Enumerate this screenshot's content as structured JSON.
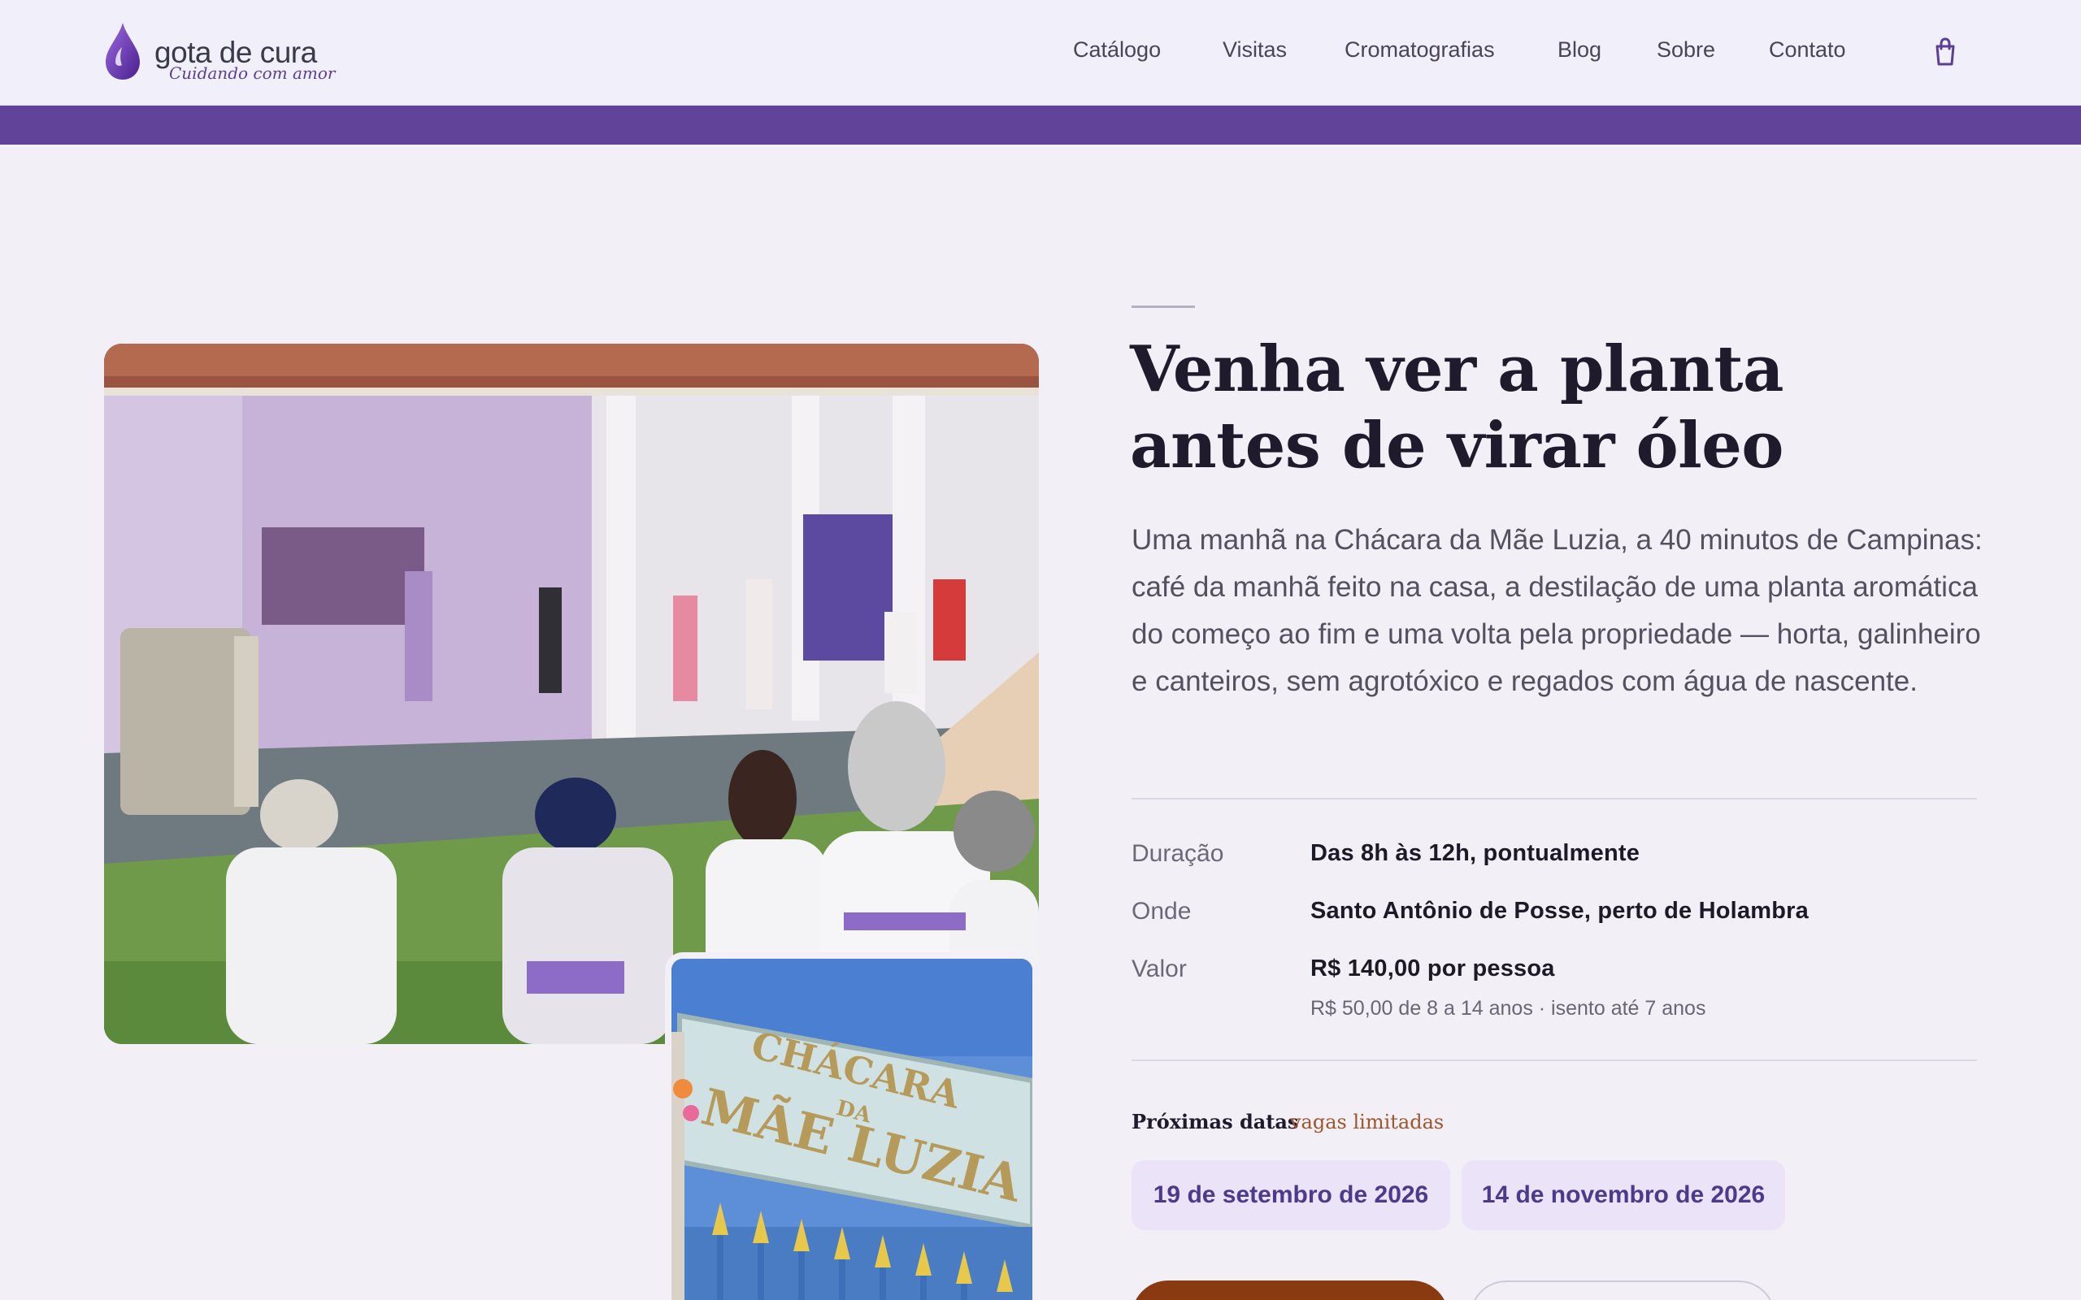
{
  "header": {
    "logo": {
      "name": "gota de cura",
      "tagline": "Cuidando com amor",
      "icon": "drop-icon"
    },
    "nav": [
      {
        "label": "Catálogo"
      },
      {
        "label": "Visitas"
      },
      {
        "label": "Cromatografias"
      },
      {
        "label": "Blog"
      },
      {
        "label": "Sobre"
      },
      {
        "label": "Contato"
      }
    ],
    "cart_icon": "shopping-bag-icon"
  },
  "colors": {
    "accent": "#61449a",
    "background": "#f2eff7",
    "cta": "#8a3a10",
    "chip_bg": "#ebe3f8",
    "chip_text": "#4e3a8a",
    "limited": "#a0552a"
  },
  "hero": {
    "title_line1": "Venha ver a planta",
    "title_line2": "antes de virar óleo",
    "lead": "Uma manhã na Chácara da Mãe Luzia, a 40 minutos de Campinas: café da manhã feito na casa, a destilação de uma planta aromática do começo ao fim e uma volta pela propriedade — horta, galinheiro e canteiros, sem agrotóxico e regados com água de nascente.",
    "photo_sign_line1": "CHÁCARA",
    "photo_sign_da": "DA",
    "photo_sign_line2": "MÃE LUZIA"
  },
  "details": [
    {
      "label": "Duração",
      "value": "Das 8h às 12h, pontualmente"
    },
    {
      "label": "Onde",
      "value": "Santo Antônio de Posse, perto de Holambra"
    },
    {
      "label": "Valor",
      "value": "R$ 140,00 por pessoa",
      "note": "R$ 50,00 de 8 a 14 anos · isento até 7 anos"
    }
  ],
  "dates": {
    "heading": "Próximas datas",
    "badge": "vagas limitadas",
    "items": [
      "19 de setembro de 2026",
      "14 de novembro de 2026"
    ]
  }
}
